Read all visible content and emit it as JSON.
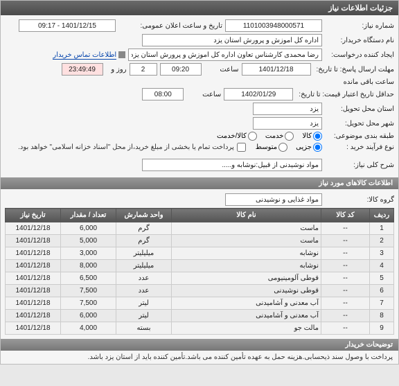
{
  "header": {
    "title": "جزئیات اطلاعات نیاز"
  },
  "form": {
    "need_no_label": "شماره نیاز:",
    "need_no": "1101003948000571",
    "ann_date_label": "تاریخ و ساعت اعلان عمومی:",
    "ann_date": "1401/12/15 - 09:17",
    "buyer_org_label": "نام دستگاه خریدار:",
    "buyer_org": "اداره کل آموزش و پرورش استان یزد",
    "creator_label": "ایجاد کننده درخواست:",
    "creator": "رضا محمدی کارشناس تعاون اداره کل آموزش و پرورش استان یزد",
    "contact_label": "اطلاعات تماس خریدار",
    "deadline_label": "مهلت ارسال پاسخ: تا تاریخ:",
    "deadline_date": "1401/12/18",
    "deadline_time_label": "ساعت",
    "deadline_time": "09:20",
    "days_remain": "2",
    "days_label": "روز و",
    "time_remain": "23:49:49",
    "time_remain_label": "ساعت باقی مانده",
    "valid_label": "حداقل تاریخ اعتبار قیمت: تا تاریخ:",
    "valid_date": "1402/01/29",
    "valid_time": "08:00",
    "province_label": "استان محل تحویل:",
    "province": "یزد",
    "city_label": "شهر محل تحویل:",
    "city": "یزد",
    "class_label": "طبقه بندی موضوعی:",
    "class_goods": "کالا",
    "class_service": "خدمت",
    "class_both": "کالا/خدمت",
    "buy_type_label": "نوع فرآیند خرید :",
    "buy_small": "جزیی",
    "buy_med": "متوسط",
    "pay_note": "پرداخت تمام یا بخشی از مبلغ خرید،از محل \"اسناد خزانه اسلامی\" خواهد بود.",
    "desc_label": "شرح کلی نیاز:",
    "desc": "مواد نوشیدنی از قبیل:نوشابه و....."
  },
  "items_header": "اطلاعات کالاهای مورد نیاز",
  "group_label": "گروه کالا:",
  "group": "مواد غذایی و نوشیدنی",
  "cols": {
    "row": "ردیف",
    "code": "کد کالا",
    "name": "نام کالا",
    "unit": "واحد شمارش",
    "qty": "تعداد / مقدار",
    "date": "تاریخ نیاز"
  },
  "rows": [
    {
      "r": "1",
      "code": "--",
      "name": "ماست",
      "unit": "گرم",
      "qty": "6,000",
      "date": "1401/12/18"
    },
    {
      "r": "2",
      "code": "--",
      "name": "ماست",
      "unit": "گرم",
      "qty": "5,000",
      "date": "1401/12/18"
    },
    {
      "r": "3",
      "code": "--",
      "name": "نوشابه",
      "unit": "میلیلیتر",
      "qty": "3,000",
      "date": "1401/12/18"
    },
    {
      "r": "4",
      "code": "--",
      "name": "نوشابه",
      "unit": "میلیلیتر",
      "qty": "8,000",
      "date": "1401/12/18"
    },
    {
      "r": "5",
      "code": "--",
      "name": "قوطی آلومینیومی",
      "unit": "عدد",
      "qty": "6,500",
      "date": "1401/12/18"
    },
    {
      "r": "6",
      "code": "--",
      "name": "قوطی نوشیدنی",
      "unit": "عدد",
      "qty": "7,500",
      "date": "1401/12/18"
    },
    {
      "r": "7",
      "code": "--",
      "name": "آب معدنی و آشامیدنی",
      "unit": "لیتر",
      "qty": "7,500",
      "date": "1401/12/18"
    },
    {
      "r": "8",
      "code": "--",
      "name": "آب معدنی و آشامیدنی",
      "unit": "لیتر",
      "qty": "6,000",
      "date": "1401/12/18"
    },
    {
      "r": "9",
      "code": "--",
      "name": "مالت جو",
      "unit": "بسته",
      "qty": "4,000",
      "date": "1401/12/18"
    }
  ],
  "notes_header": "توضیحات خریدار",
  "notes": "پرداخت با وصول سند ذیحسابی.هزینه حمل به عهده تأمین کننده می باشد.تأمین کننده باید از استان یزد باشد."
}
